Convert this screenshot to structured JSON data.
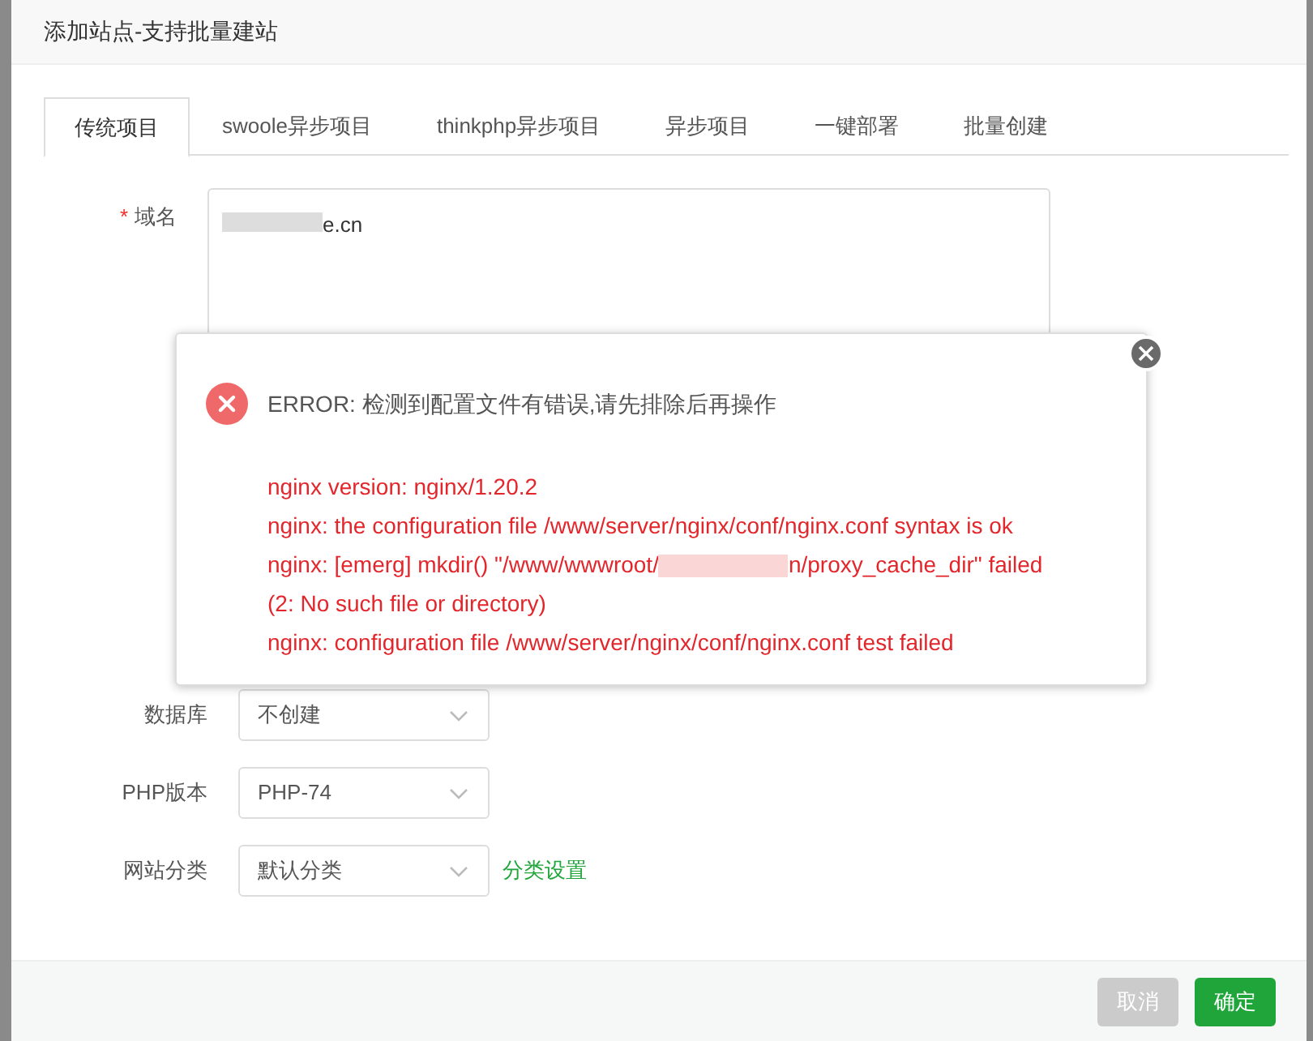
{
  "dialog": {
    "title": "添加站点-支持批量建站"
  },
  "tabs": [
    {
      "label": "传统项目",
      "selected": true
    },
    {
      "label": "swoole异步项目",
      "selected": false
    },
    {
      "label": "thinkphp异步项目",
      "selected": false
    },
    {
      "label": "异步项目",
      "selected": false
    },
    {
      "label": "一键部署",
      "selected": false
    },
    {
      "label": "批量创建",
      "selected": false
    }
  ],
  "domain": {
    "label": "域名",
    "required_mark": "*",
    "value": "e.cn"
  },
  "selects": [
    {
      "label": "数据库",
      "value": "不创建"
    },
    {
      "label": "PHP版本",
      "value": "PHP-74"
    },
    {
      "label": "网站分类",
      "value": "默认分类",
      "link": "分类设置"
    }
  ],
  "error": {
    "title": "ERROR: 检测到配置文件有错误,请先排除后再操作",
    "lines": [
      {
        "text": "nginx version: nginx/1.20.2"
      },
      {
        "text": "nginx: the configuration file /www/server/nginx/conf/nginx.conf syntax is ok"
      },
      {
        "text": "nginx: [emerg] mkdir() \"/www/wwwroot/",
        "after": "n/proxy_cache_dir\" failed"
      },
      {
        "text": "(2: No such file or directory)"
      },
      {
        "text": "nginx: configuration file /www/server/nginx/conf/nginx.conf test failed"
      }
    ]
  },
  "buttons": {
    "cancel": "取消",
    "confirm": "确定"
  }
}
